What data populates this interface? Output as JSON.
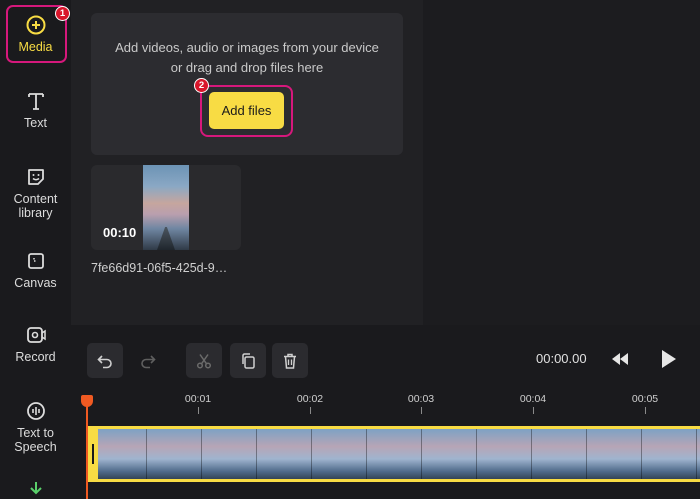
{
  "sidebar": {
    "items": [
      {
        "label": "Media",
        "icon": "plus-circle-icon",
        "active": true
      },
      {
        "label": "Text",
        "icon": "text-icon"
      },
      {
        "label": "Content library",
        "icon": "sticker-icon"
      },
      {
        "label": "Canvas",
        "icon": "canvas-icon"
      },
      {
        "label": "Record",
        "icon": "record-icon"
      },
      {
        "label": "Text to Speech",
        "icon": "speech-icon"
      },
      {
        "label": "",
        "icon": "download-icon"
      }
    ],
    "accent": "#d6187c"
  },
  "annotations": {
    "badge1": "1",
    "badge2": "2"
  },
  "upload": {
    "line1": "Add videos, audio or images from your device",
    "line2": "or drag and drop files here",
    "button_label": "Add files",
    "button_color": "#f8dc44"
  },
  "media_item": {
    "duration": "00:10",
    "file_name": "7fe66d91-06f5-425d-9…"
  },
  "toolbar": {
    "undo_icon": "undo-icon",
    "redo_icon": "redo-icon",
    "cut_icon": "scissors-icon",
    "copy_icon": "copy-icon",
    "delete_icon": "trash-icon",
    "time": "00:00.00"
  },
  "timeline": {
    "ticks": [
      "00:01",
      "00:02",
      "00:03",
      "00:04",
      "00:05"
    ],
    "playhead_color": "#f05a22"
  }
}
